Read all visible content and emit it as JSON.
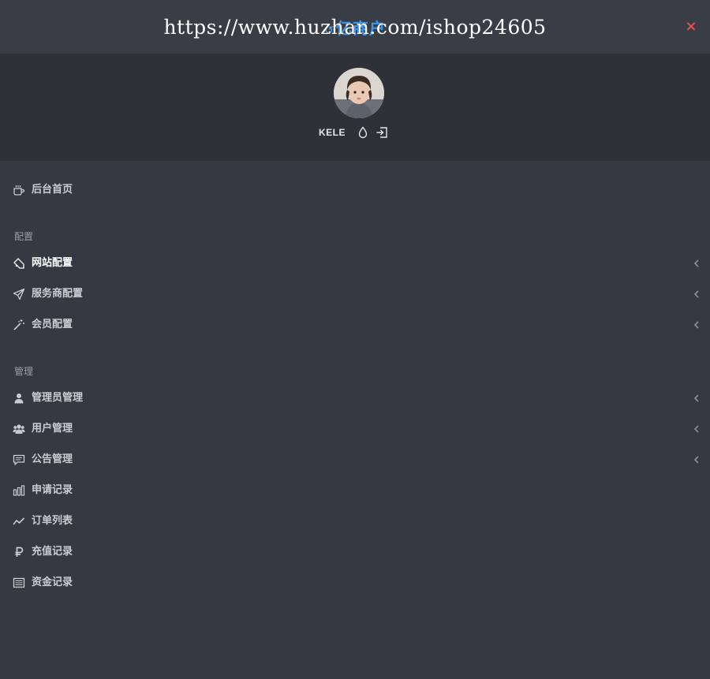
{
  "header": {
    "brand_mark": "↺",
    "brand": "亿商户",
    "watermark": "https://www.huzhan.com/ishop24605",
    "close_label": "×"
  },
  "user": {
    "name": "KELE"
  },
  "menu": {
    "home": {
      "label": "后台首页",
      "icon": "coffee-icon"
    },
    "sections": [
      {
        "title": "配置",
        "items": [
          {
            "label": "网站配置",
            "icon": "tag-icon",
            "has_submenu": true,
            "active": true
          },
          {
            "label": "服务商配置",
            "icon": "paper-plane-icon",
            "has_submenu": true
          },
          {
            "label": "会员配置",
            "icon": "magic-wand-icon",
            "has_submenu": true
          }
        ]
      },
      {
        "title": "管理",
        "items": [
          {
            "label": "管理员管理",
            "icon": "user-icon",
            "has_submenu": true
          },
          {
            "label": "用户管理",
            "icon": "users-icon",
            "has_submenu": true
          },
          {
            "label": "公告管理",
            "icon": "comment-icon",
            "has_submenu": true
          },
          {
            "label": "申请记录",
            "icon": "bar-chart-icon"
          },
          {
            "label": "订单列表",
            "icon": "line-chart-icon"
          },
          {
            "label": "充值记录",
            "icon": "ruble-icon"
          },
          {
            "label": "资金记录",
            "icon": "list-alt-icon"
          }
        ]
      }
    ]
  }
}
